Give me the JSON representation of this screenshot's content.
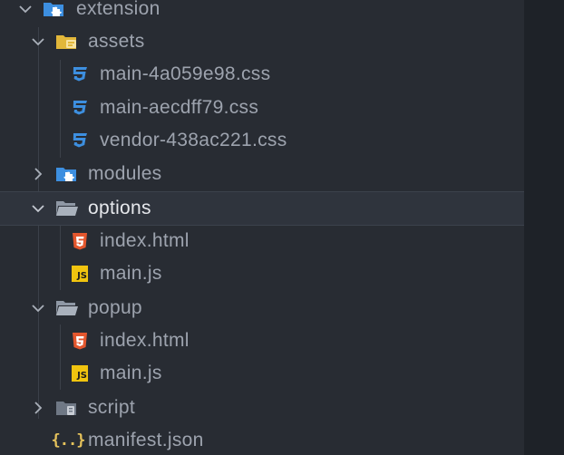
{
  "tree": {
    "items": [
      {
        "label": "extension",
        "icon": "folder-extension-open-icon",
        "state": "expanded"
      },
      {
        "label": "assets",
        "icon": "folder-assets-open-icon",
        "state": "expanded"
      },
      {
        "label": "main-4a059e98.css",
        "icon": "css-file-icon"
      },
      {
        "label": "main-aecdff79.css",
        "icon": "css-file-icon"
      },
      {
        "label": "vendor-438ac221.css",
        "icon": "css-file-icon"
      },
      {
        "label": "modules",
        "icon": "folder-modules-icon",
        "state": "collapsed"
      },
      {
        "label": "options",
        "icon": "folder-open-icon",
        "state": "expanded",
        "selected": true
      },
      {
        "label": "index.html",
        "icon": "html-file-icon"
      },
      {
        "label": "main.js",
        "icon": "js-file-icon",
        "badge": "JS"
      },
      {
        "label": "popup",
        "icon": "folder-open-icon",
        "state": "expanded"
      },
      {
        "label": "index.html",
        "icon": "html-file-icon"
      },
      {
        "label": "main.js",
        "icon": "js-file-icon",
        "badge": "JS"
      },
      {
        "label": "script",
        "icon": "folder-script-icon",
        "state": "collapsed"
      },
      {
        "label": "manifest.json",
        "icon": "json-file-icon",
        "glyph": "{..}"
      }
    ]
  },
  "colors": {
    "background": "#282c33",
    "selected_row": "#2f343d",
    "text": "#9da3ae",
    "css_icon": "#3d8fe0",
    "html_icon": "#e4572e",
    "js_icon": "#f1c40f",
    "json_icon": "#e6c35c",
    "folder": "#8f98a5",
    "folder_blue": "#3d8fe0",
    "folder_yellow": "#e2b73a"
  }
}
